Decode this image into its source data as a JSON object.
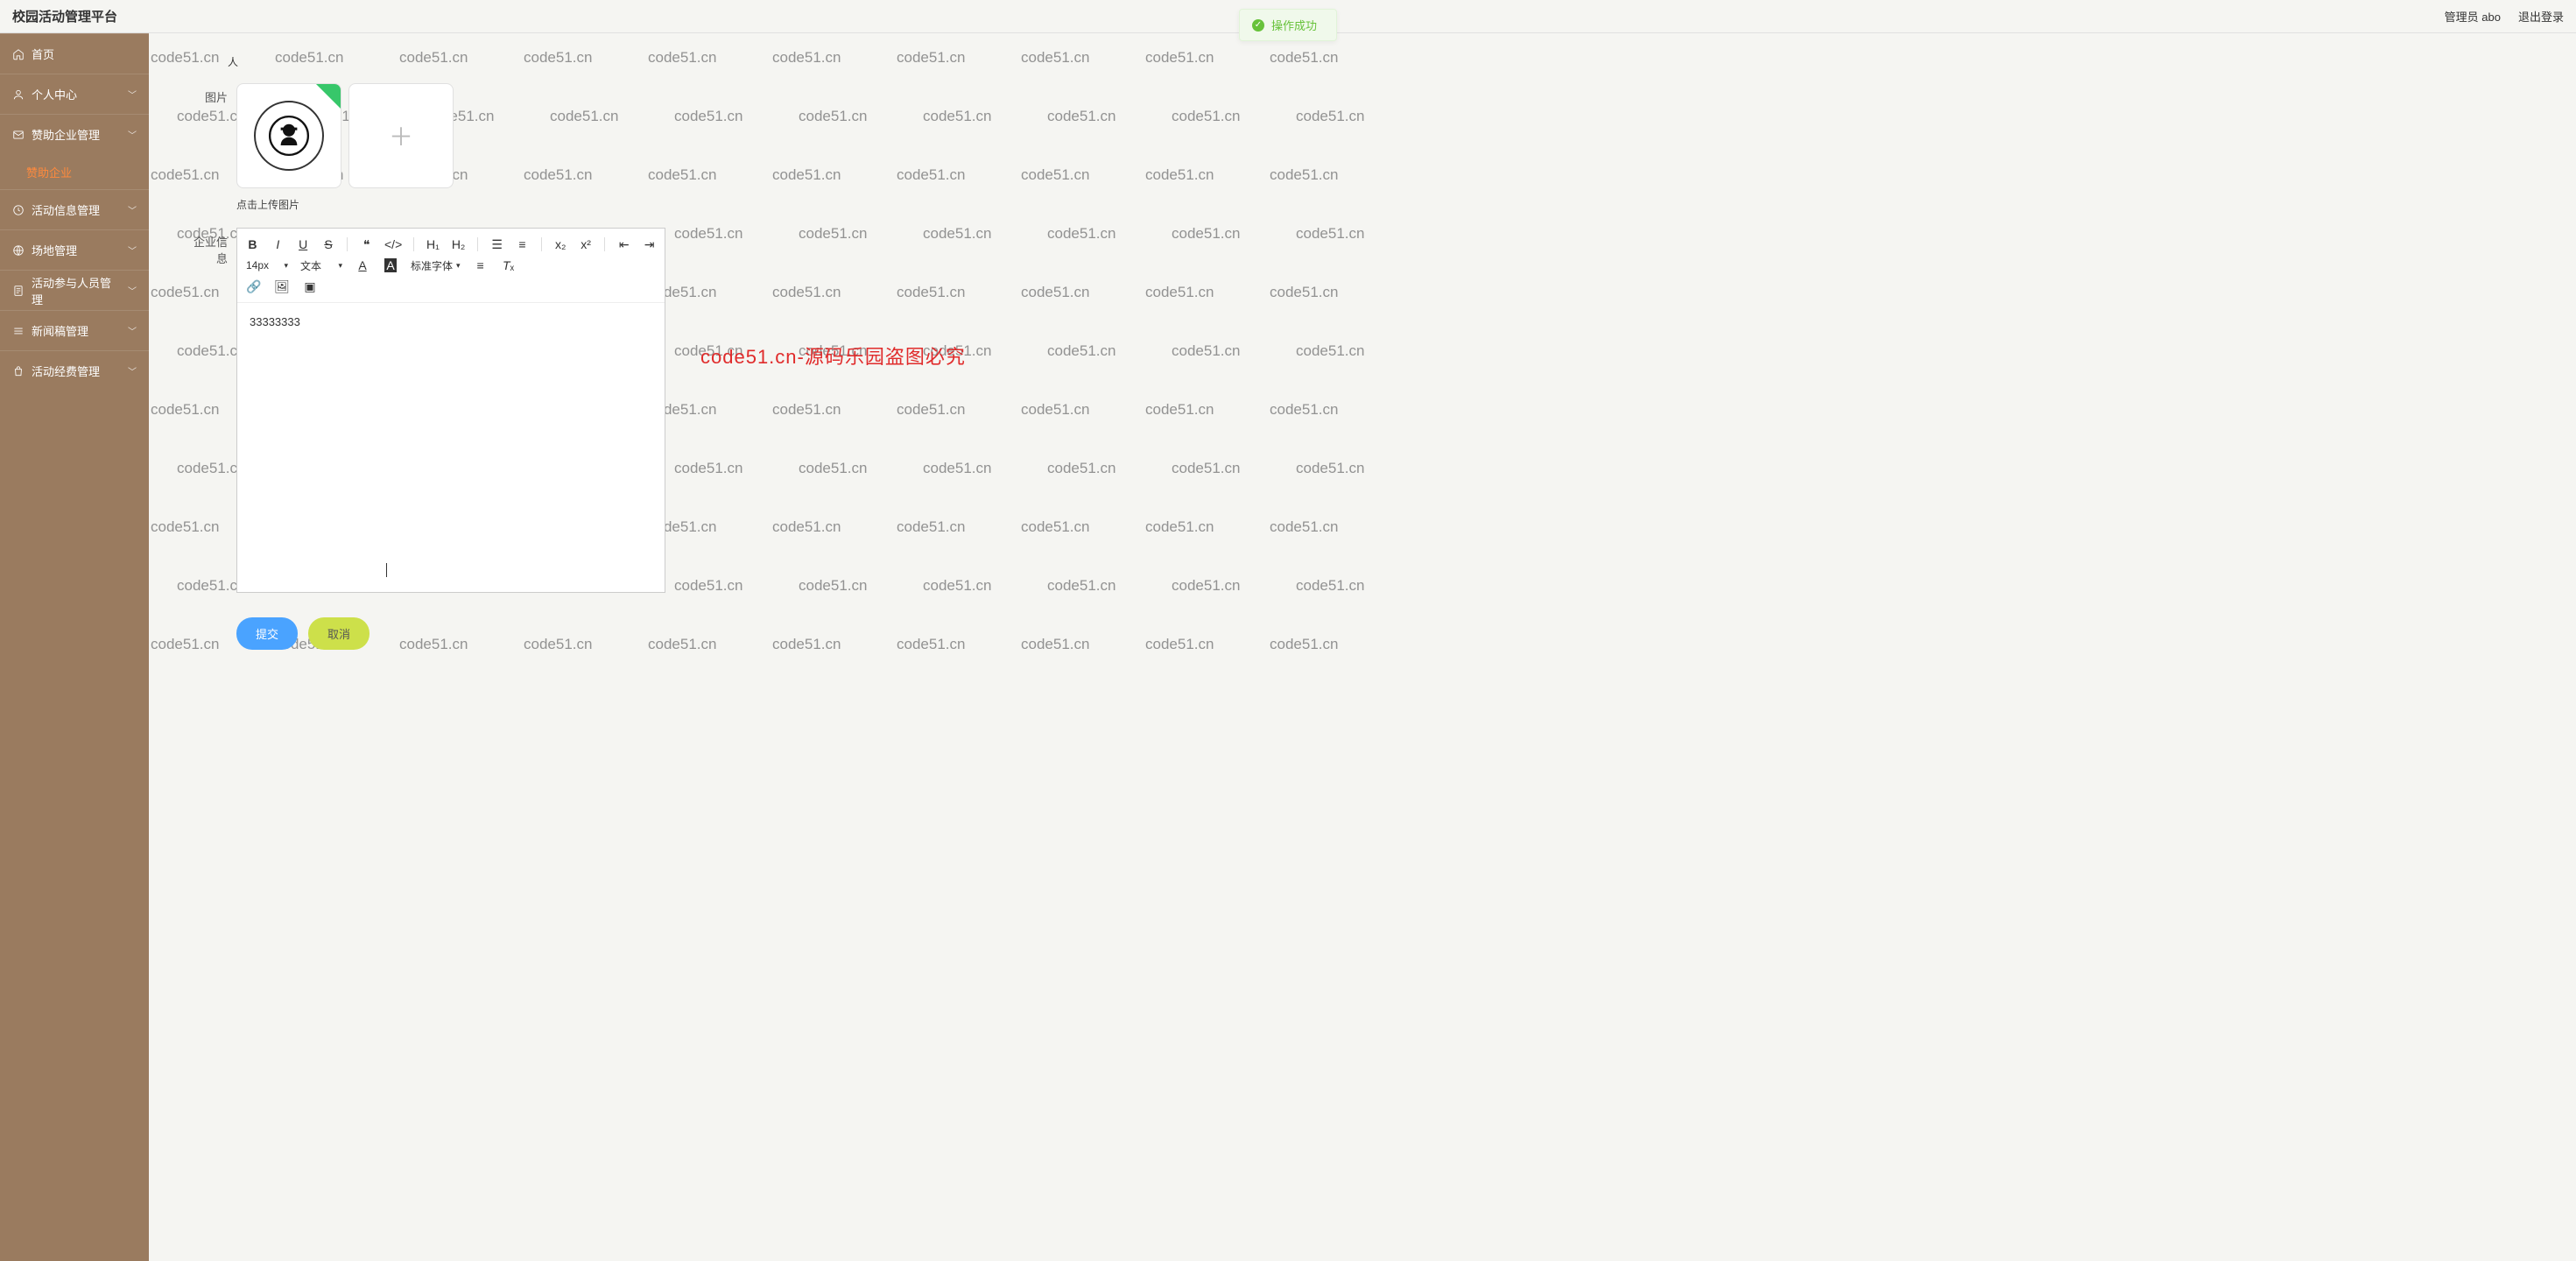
{
  "header": {
    "brand": "校园活动管理平台",
    "user_prefix": "管理员",
    "user_name": "abo",
    "logout": "退出登录"
  },
  "toast": {
    "text": "操作成功"
  },
  "sidebar": {
    "items": [
      {
        "icon": "home",
        "label": "首页"
      },
      {
        "icon": "user",
        "label": "个人中心",
        "chev": true
      },
      {
        "icon": "env",
        "label": "赞助企业管理",
        "chev": true,
        "expanded": true
      },
      {
        "sub": true,
        "label": "赞助企业"
      },
      {
        "icon": "clock",
        "label": "活动信息管理",
        "chev": true
      },
      {
        "icon": "globe",
        "label": "场地管理",
        "chev": true
      },
      {
        "icon": "doc",
        "label": "活动参与人员管理",
        "chev": true
      },
      {
        "icon": "lines",
        "label": "新闻稿管理",
        "chev": true
      },
      {
        "icon": "bag",
        "label": "活动经费管理",
        "chev": true
      }
    ]
  },
  "form": {
    "char_left_label": "人",
    "image_label": "图片",
    "upload_tip": "点击上传图片",
    "info_label": "企业信息",
    "editor_text": "33333333",
    "submit": "提交",
    "cancel": "取消"
  },
  "editor_toolbar": {
    "font_size": "14px",
    "block_type": "文本",
    "font_family": "标准字体"
  },
  "watermark": {
    "text": "code51.cn",
    "red_text": "code51.cn-源码乐园盗图必究"
  }
}
